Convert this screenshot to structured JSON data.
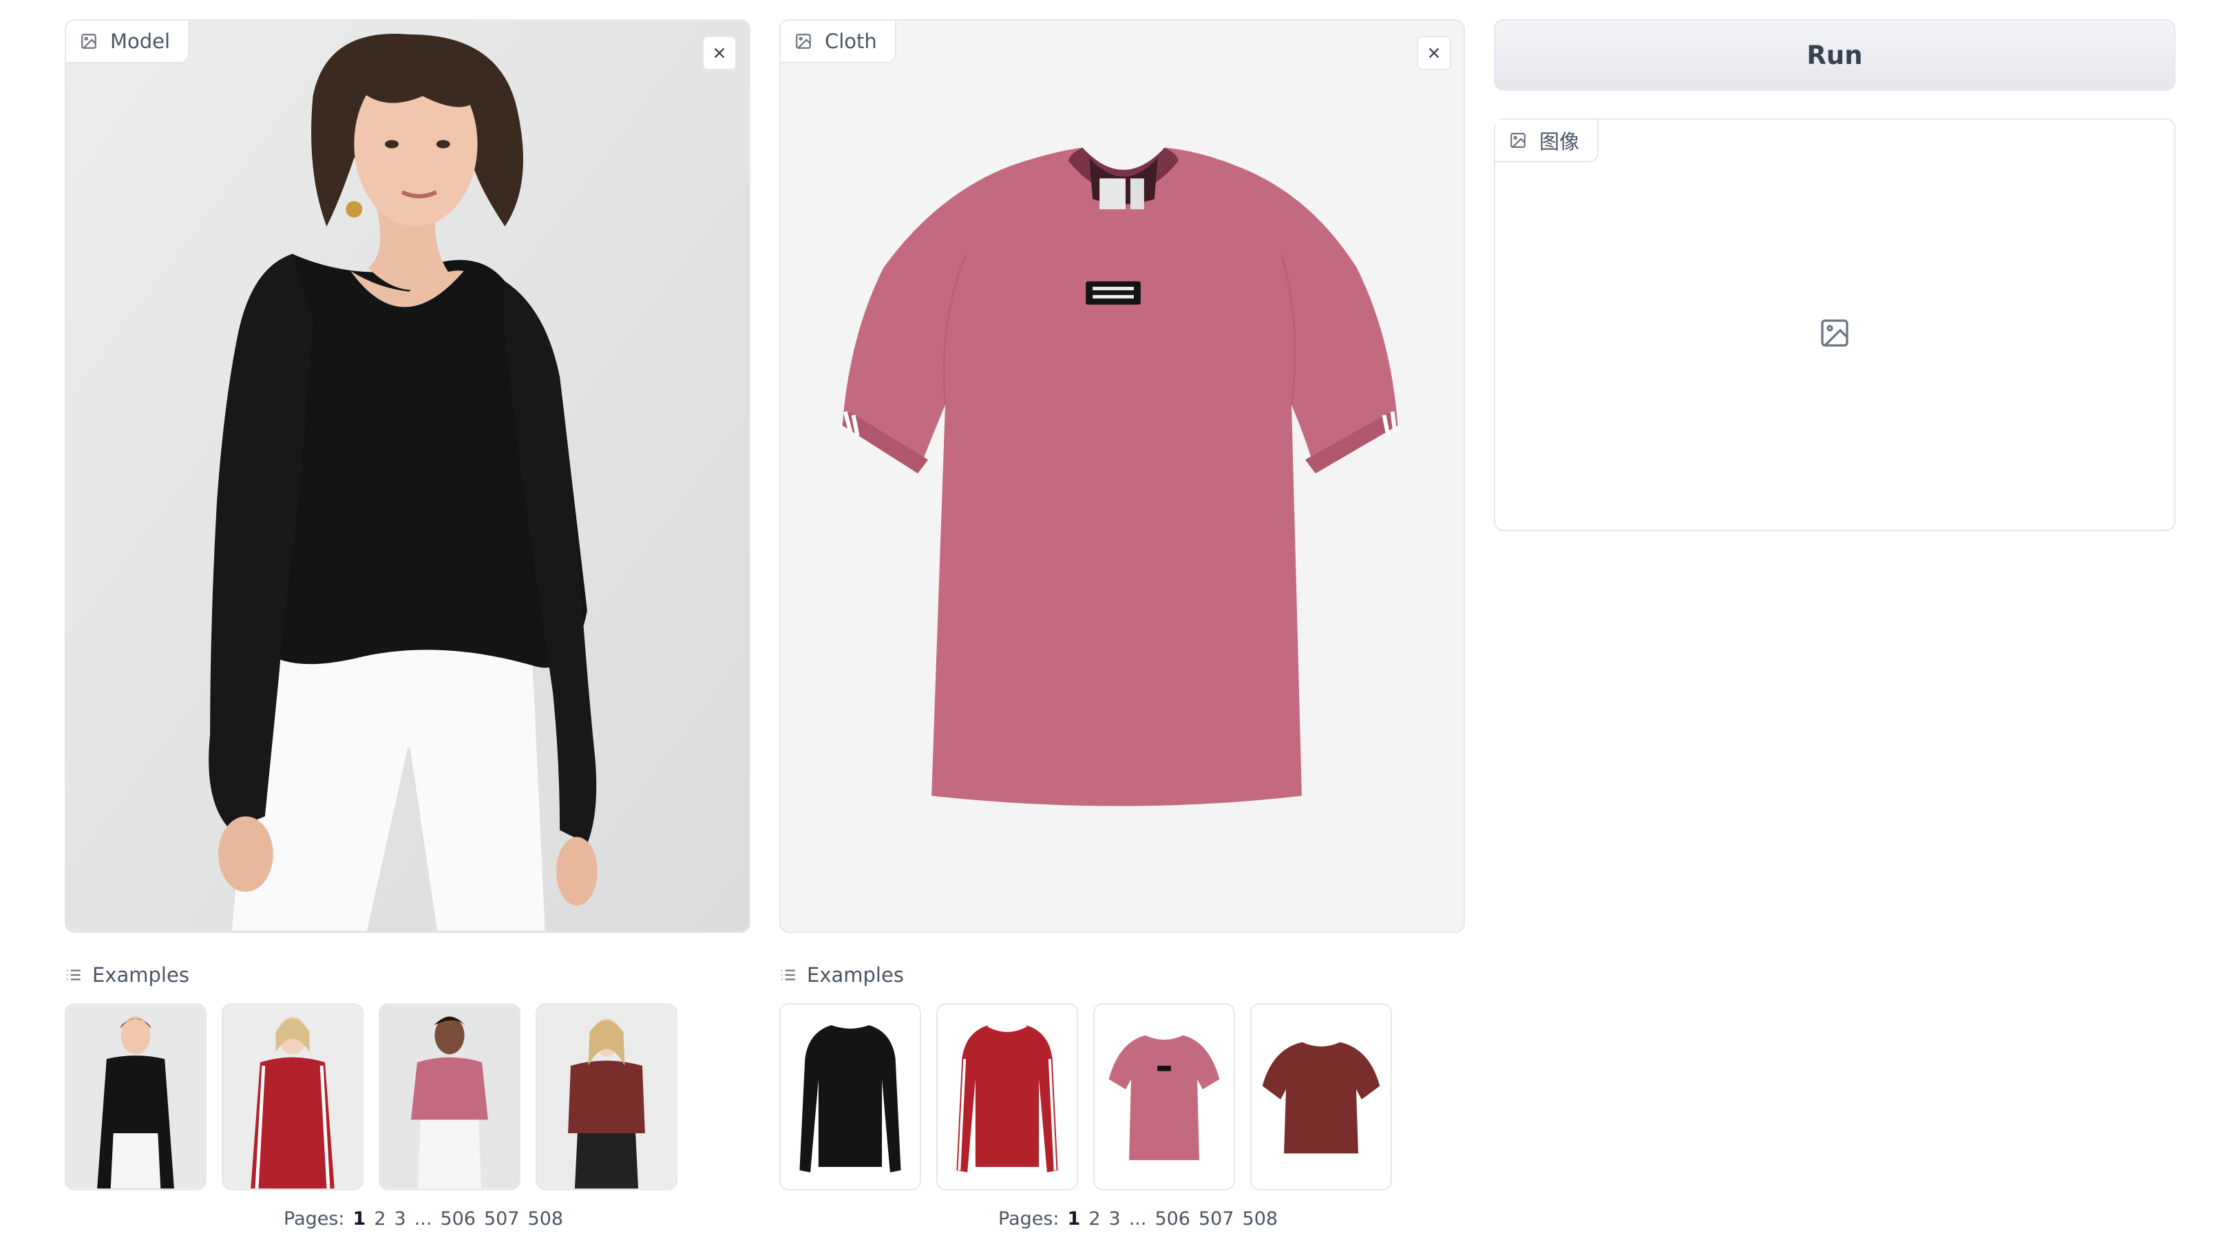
{
  "model_panel": {
    "label": "Model",
    "icon": "image-icon",
    "close_icon": "close-icon"
  },
  "cloth_panel": {
    "label": "Cloth",
    "icon": "image-icon",
    "close_icon": "close-icon"
  },
  "run_button": {
    "label": "Run"
  },
  "output_panel": {
    "label": "图像",
    "icon": "image-icon",
    "empty_icon": "image-placeholder-icon"
  },
  "model_examples": {
    "label": "Examples",
    "items": [
      {
        "desc": "model in black long-sleeve top"
      },
      {
        "desc": "model in red striped long-sleeve top"
      },
      {
        "desc": "model in pink t-shirt"
      },
      {
        "desc": "model in maroon t-shirt"
      }
    ],
    "pager": {
      "prefix": "Pages:",
      "pages": [
        "1",
        "2",
        "3",
        "...",
        "506",
        "507",
        "508"
      ],
      "active": "1"
    }
  },
  "cloth_examples": {
    "label": "Examples",
    "items": [
      {
        "desc": "black long-sleeve top"
      },
      {
        "desc": "red long-sleeve top with white stripes"
      },
      {
        "desc": "pink t-shirt"
      },
      {
        "desc": "maroon t-shirt"
      }
    ],
    "pager": {
      "prefix": "Pages:",
      "pages": [
        "1",
        "2",
        "3",
        "...",
        "506",
        "507",
        "508"
      ],
      "active": "1"
    }
  },
  "colors": {
    "pink_tee": "#c46a80",
    "black_top": "#141414",
    "red_top": "#b3212b",
    "maroon_top": "#7a2e2c",
    "panel_bg": "#f4f4f5",
    "border": "#e5e7eb"
  }
}
